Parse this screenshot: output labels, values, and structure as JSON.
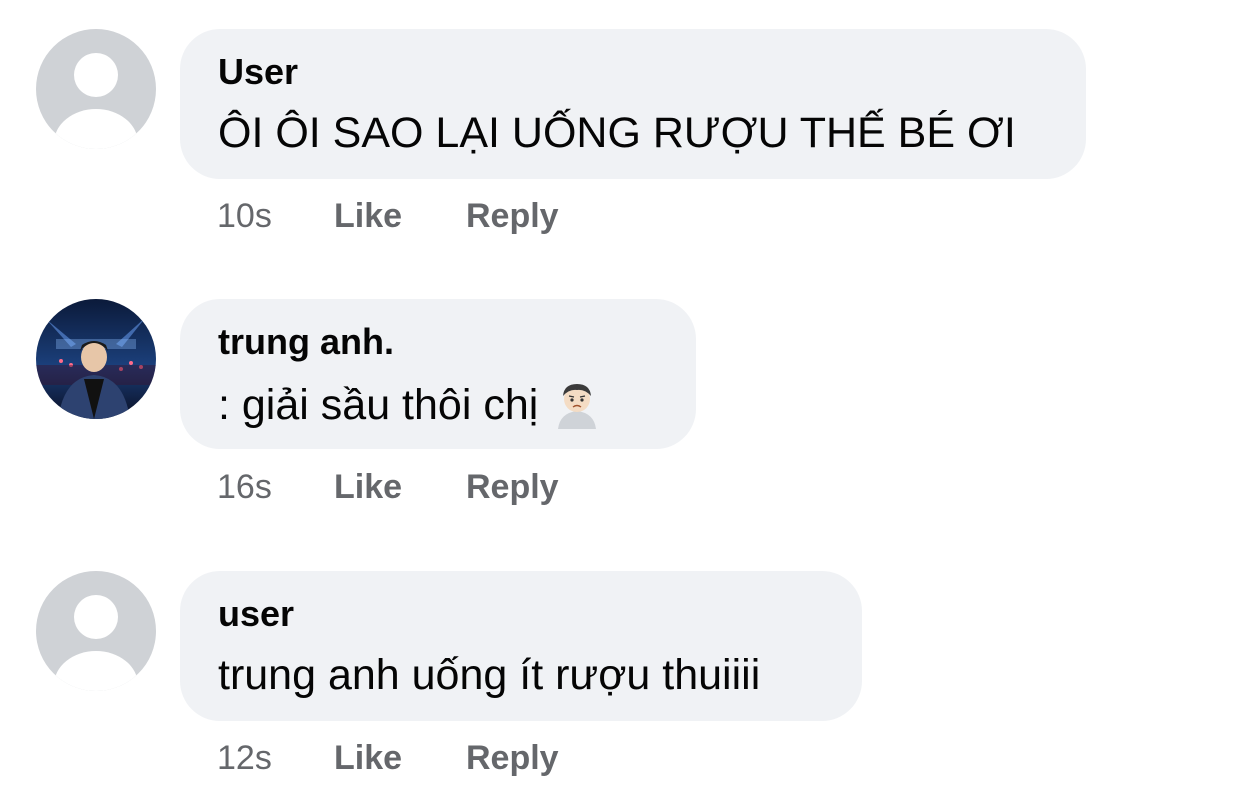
{
  "comments": [
    {
      "author": "User",
      "text": "ÔI ÔI SAO LẠI UỐNG RƯỢU THẾ BÉ ƠI",
      "time": "10s",
      "like_label": "Like",
      "reply_label": "Reply",
      "avatar": "default-avatar-icon"
    },
    {
      "author": "trung anh.",
      "text": ": giải sầu thôi chị",
      "emoji": "sad-face-emoji",
      "time": "16s",
      "like_label": "Like",
      "reply_label": "Reply",
      "avatar": "profile-photo-concert"
    },
    {
      "author": "user",
      "text": "trung anh uống ít rượu thuiiii",
      "time": "12s",
      "like_label": "Like",
      "reply_label": "Reply",
      "avatar": "default-avatar-icon"
    }
  ],
  "colors": {
    "bubble": "#f0f2f5",
    "meta_text": "#65676b",
    "default_avatar_bg": "#cfd2d6"
  }
}
